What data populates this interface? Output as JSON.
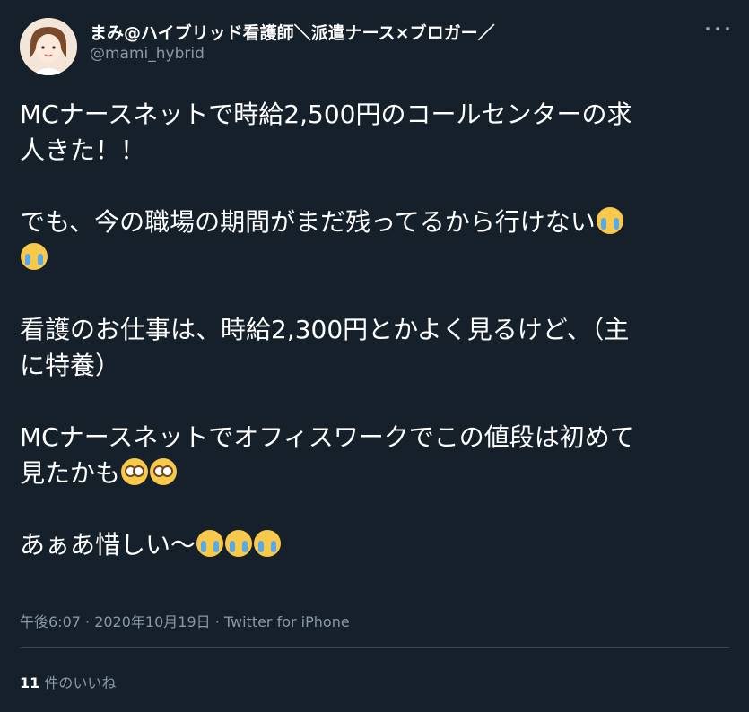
{
  "user": {
    "display_name": "まみ@ハイブリッド看護師＼派遣ナース×ブロガー／",
    "handle": "@mami_hybrid"
  },
  "tweet": {
    "p1_line1": "MCナースネットで時給2,500円のコールセンターの求",
    "p1_line2": "人きた！！",
    "p2_line1": "でも、今の職場の期間がまだ残ってるから行けない",
    "p3_line1": "看護のお仕事は、時給2,300円とかよく見るけど、（主",
    "p3_line2": "に特養）",
    "p4_line1": "MCナースネットでオフィスワークでこの値段は初めて",
    "p4_line2": "見たかも",
    "p5_line1": "あぁあ惜しい〜"
  },
  "meta": {
    "timestamp": "午後6:07 · 2020年10月19日 · Twitter for iPhone"
  },
  "likes": {
    "count": "11",
    "label": " 件のいいね"
  },
  "icons": {
    "more": "more-icon",
    "crying": "loudly-crying-face-emoji",
    "flushed": "flushed-face-emoji"
  },
  "colors": {
    "background": "#15202b",
    "text": "#ffffff",
    "secondary": "#8899a6",
    "divider": "#38444d"
  }
}
